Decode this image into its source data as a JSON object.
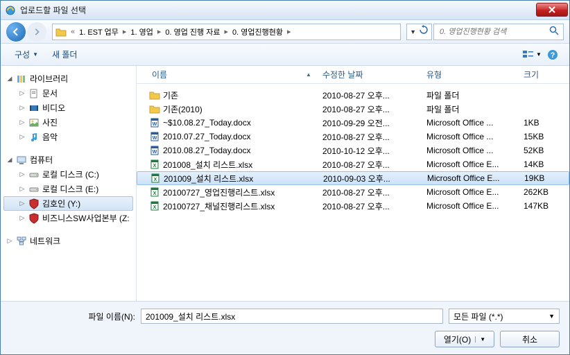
{
  "title": "업로드할 파일 선택",
  "breadcrumb": [
    "1. EST 업무",
    "1. 영업",
    "0. 영업 진행 자료",
    "0. 영업진행현황"
  ],
  "search_placeholder": "0. 영업진행현황 검색",
  "toolbar": {
    "organize": "구성",
    "new_folder": "새 폴더"
  },
  "columns": {
    "name": "이름",
    "date": "수정한 날짜",
    "type": "유형",
    "size": "크기"
  },
  "tree": {
    "libraries": {
      "label": "라이브러리",
      "docs": "문서",
      "videos": "비디오",
      "pictures": "사진",
      "music": "음악"
    },
    "computer": {
      "label": "컴퓨터",
      "c": "로컬 디스크 (C:)",
      "e": "로컬 디스크 (E:)",
      "y": "김호인 (Y:)",
      "z": "비즈니스SW사업본부 (Z:"
    },
    "network": {
      "label": "네트워크"
    }
  },
  "files": [
    {
      "name": "기존",
      "date": "2010-08-27 오후...",
      "type": "파일 폴더",
      "size": "",
      "icon": "folder",
      "selected": false
    },
    {
      "name": "기존(2010)",
      "date": "2010-08-27 오후...",
      "type": "파일 폴더",
      "size": "",
      "icon": "folder",
      "selected": false
    },
    {
      "name": "~$10.08.27_Today.docx",
      "date": "2010-09-29 오전...",
      "type": "Microsoft Office ...",
      "size": "1KB",
      "icon": "docx",
      "selected": false
    },
    {
      "name": "2010.07.27_Today.docx",
      "date": "2010-08-27 오후...",
      "type": "Microsoft Office ...",
      "size": "15KB",
      "icon": "docx",
      "selected": false
    },
    {
      "name": "2010.08.27_Today.docx",
      "date": "2010-10-12 오후...",
      "type": "Microsoft Office ...",
      "size": "52KB",
      "icon": "docx",
      "selected": false
    },
    {
      "name": "201008_설치 리스트.xlsx",
      "date": "2010-08-27 오후...",
      "type": "Microsoft Office E...",
      "size": "14KB",
      "icon": "xlsx",
      "selected": false
    },
    {
      "name": "201009_설치 리스트.xlsx",
      "date": "2010-09-03 오후...",
      "type": "Microsoft Office E...",
      "size": "19KB",
      "icon": "xlsx",
      "selected": true
    },
    {
      "name": "20100727_영업진행리스트.xlsx",
      "date": "2010-08-27 오후...",
      "type": "Microsoft Office E...",
      "size": "262KB",
      "icon": "xlsx",
      "selected": false
    },
    {
      "name": "20100727_채널진행리스트.xlsx",
      "date": "2010-08-27 오후...",
      "type": "Microsoft Office E...",
      "size": "147KB",
      "icon": "xlsx",
      "selected": false
    }
  ],
  "filename_label": "파일 이름(N):",
  "filename_value": "201009_설치 리스트.xlsx",
  "filetype": "모든 파일 (*.*)",
  "open_btn": "열기(O)",
  "cancel_btn": "취소"
}
